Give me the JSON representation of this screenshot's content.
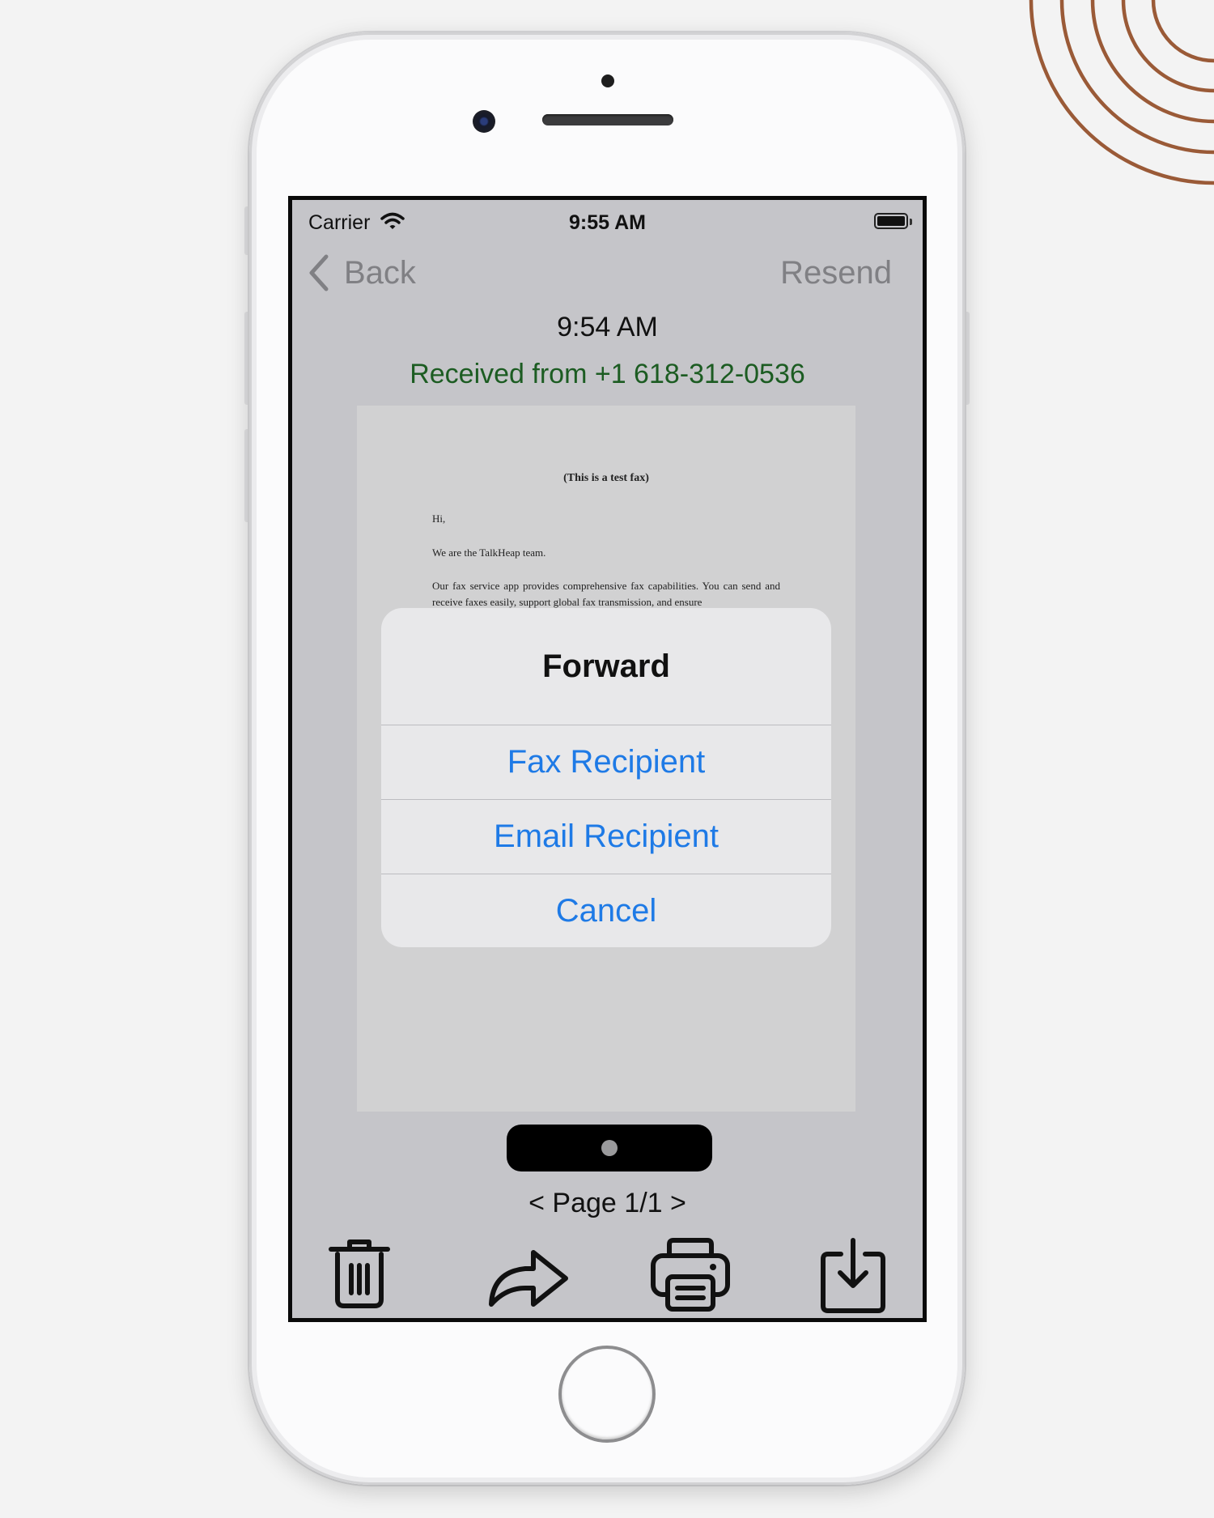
{
  "status_bar": {
    "carrier": "Carrier",
    "time": "9:55 AM"
  },
  "nav": {
    "back_label": "Back",
    "resend_label": "Resend"
  },
  "fax": {
    "time": "9:54 AM",
    "from": "Received from +1 618-312-0536",
    "from_color": "#1c5c22"
  },
  "document": {
    "title": "(This is a test fax)",
    "greeting": "Hi,",
    "line1": "We are the TalkHeap team.",
    "line2": "Our fax service app provides comprehensive fax capabilities. You can send and receive faxes easily, support global fax transmission, and ensure"
  },
  "alert": {
    "title": "Forward",
    "options": [
      {
        "label": "Fax Recipient"
      },
      {
        "label": "Email Recipient"
      },
      {
        "label": "Cancel"
      }
    ],
    "accent_color": "#1e7ae6"
  },
  "pagination": {
    "label": "< Page 1/1 >"
  },
  "toolbar": {
    "icons": [
      "trash-icon",
      "share-forward-icon",
      "printer-icon",
      "download-icon"
    ]
  }
}
